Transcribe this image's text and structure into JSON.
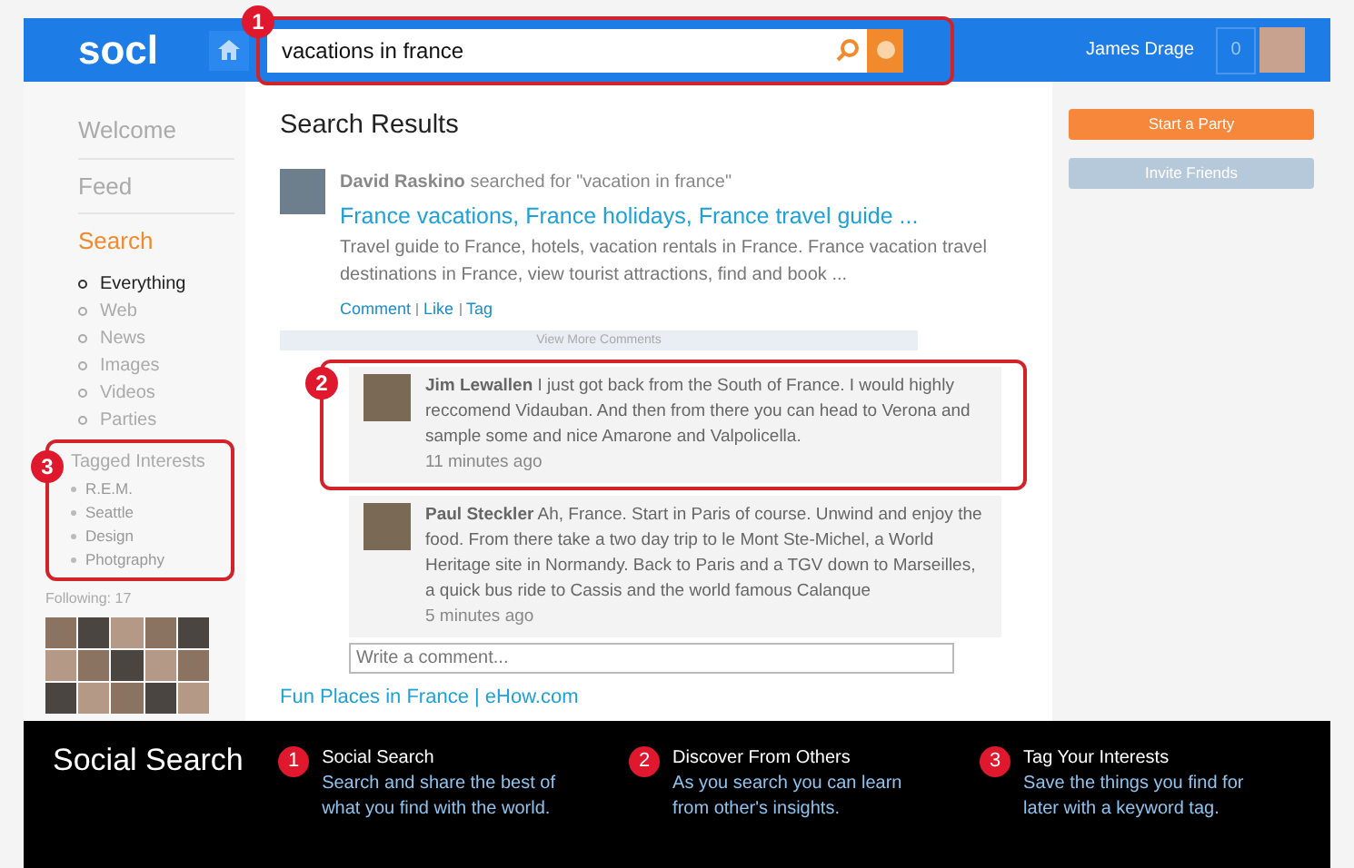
{
  "header": {
    "logo": "socl",
    "search": {
      "value": "vacations in france",
      "callout": "1"
    },
    "user_name": "James Drage",
    "notification_count": "0"
  },
  "sidebar": {
    "nav": [
      {
        "label": "Welcome",
        "selected": false
      },
      {
        "label": "Feed",
        "selected": false
      },
      {
        "label": "Search",
        "selected": true
      }
    ],
    "filters": [
      {
        "label": "Everything",
        "selected": true
      },
      {
        "label": "Web",
        "selected": false
      },
      {
        "label": "News",
        "selected": false
      },
      {
        "label": "Images",
        "selected": false
      },
      {
        "label": "Videos",
        "selected": false
      },
      {
        "label": "Parties",
        "selected": false
      }
    ],
    "tagged_interests": {
      "callout": "3",
      "title": "Tagged Interests",
      "items": [
        "R.E.M.",
        "Seattle",
        "Design",
        "Photgraphy"
      ]
    },
    "following": "Following: 17"
  },
  "main": {
    "title": "Search Results",
    "result": {
      "author": "David Raskino",
      "action": "searched for \"vacation in france\"",
      "link": "France vacations, France holidays, France travel guide ...",
      "snippet": "Travel guide to France, hotels, vacation rentals in France. France vacation travel destinations in France, view tourist attractions, find and book ...",
      "actions": [
        "Comment",
        "Like",
        "Tag"
      ],
      "view_more": "View More Comments",
      "comments": [
        {
          "author": "Jim Lewallen",
          "text": "I just got back from the South of France. I would highly reccomend Vidauban. And then from there you can head to Verona and sample some  and nice Amarone and Valpolicella.",
          "time": "11 minutes ago",
          "callout": "2"
        },
        {
          "author": "Paul Steckler",
          "text": "Ah, France. Start in Paris of course. Unwind and enjoy the food. From there take a two day trip to le Mont Ste-Michel, a World Heritage site in Normandy. Back to Paris and a TGV down to Marseilles, a quick bus ride to Cassis and the world  famous Calanque",
          "time": "5 minutes ago"
        }
      ],
      "comment_placeholder": "Write a comment..."
    },
    "next_result_link": "Fun Places in France | eHow.com"
  },
  "right": {
    "buttons": [
      {
        "label": "Start a Party",
        "kind": "primary"
      },
      {
        "label": "Invite Friends",
        "kind": "secondary"
      }
    ]
  },
  "footer": {
    "title": "Social Search",
    "features": [
      {
        "number": "1",
        "title": "Social Search",
        "text": "Search and share the best of what you find with the world."
      },
      {
        "number": "2",
        "title": "Discover From Others",
        "text": "As you search you can learn from other's insights."
      },
      {
        "number": "3",
        "title": "Tag Your Interests",
        "text": "Save the things you find for later with a keyword tag."
      }
    ]
  }
}
